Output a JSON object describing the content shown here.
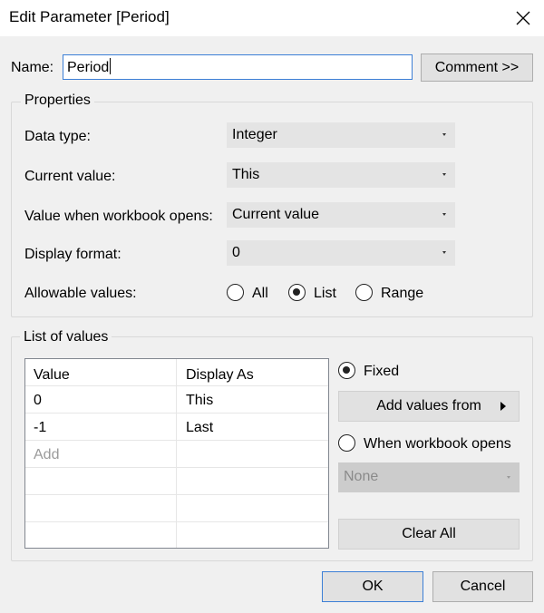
{
  "window": {
    "title": "Edit Parameter [Period]",
    "close_icon": "close-icon"
  },
  "name": {
    "label": "Name:",
    "value": "Period",
    "comment_button": "Comment >>"
  },
  "properties": {
    "title": "Properties",
    "data_type": {
      "label": "Data type:",
      "value": "Integer"
    },
    "current_value": {
      "label": "Current value:",
      "value": "This"
    },
    "value_when_opens": {
      "label": "Value when workbook opens:",
      "value": "Current value"
    },
    "display_format": {
      "label": "Display format:",
      "value": "0"
    },
    "allowable": {
      "label": "Allowable values:",
      "options": [
        "All",
        "List",
        "Range"
      ],
      "selected": "List"
    }
  },
  "list_of_values": {
    "title": "List of values",
    "columns": [
      "Value",
      "Display As"
    ],
    "rows": [
      {
        "value": "0",
        "display": "This"
      },
      {
        "value": "-1",
        "display": "Last"
      }
    ],
    "add_placeholder": "Add",
    "fixed_label": "Fixed",
    "fixed_selected": true,
    "add_values_from": "Add values from",
    "when_opens_label": "When workbook opens",
    "when_opens_value": "None",
    "clear_all": "Clear All"
  },
  "footer": {
    "ok": "OK",
    "cancel": "Cancel"
  },
  "colors": {
    "accent": "#3c7fd6",
    "background": "#f0f0f0",
    "button": "#e1e1e1"
  }
}
